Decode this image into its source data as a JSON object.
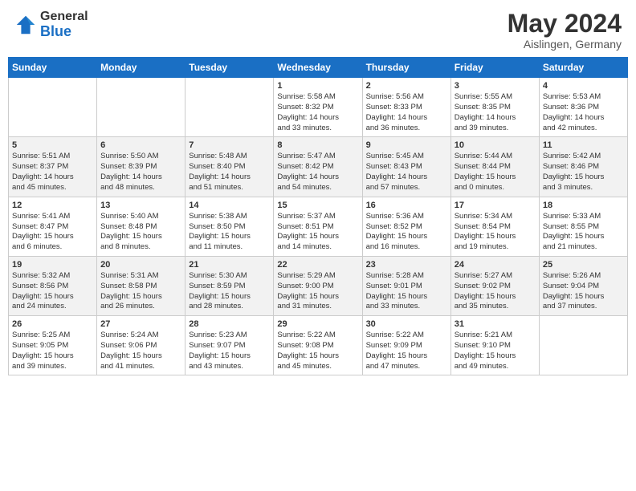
{
  "header": {
    "logo_general": "General",
    "logo_blue": "Blue",
    "title": "May 2024",
    "subtitle": "Aislingen, Germany"
  },
  "calendar": {
    "days_of_week": [
      "Sunday",
      "Monday",
      "Tuesday",
      "Wednesday",
      "Thursday",
      "Friday",
      "Saturday"
    ],
    "weeks": [
      [
        {
          "day": "",
          "info": ""
        },
        {
          "day": "",
          "info": ""
        },
        {
          "day": "",
          "info": ""
        },
        {
          "day": "1",
          "info": "Sunrise: 5:58 AM\nSunset: 8:32 PM\nDaylight: 14 hours\nand 33 minutes."
        },
        {
          "day": "2",
          "info": "Sunrise: 5:56 AM\nSunset: 8:33 PM\nDaylight: 14 hours\nand 36 minutes."
        },
        {
          "day": "3",
          "info": "Sunrise: 5:55 AM\nSunset: 8:35 PM\nDaylight: 14 hours\nand 39 minutes."
        },
        {
          "day": "4",
          "info": "Sunrise: 5:53 AM\nSunset: 8:36 PM\nDaylight: 14 hours\nand 42 minutes."
        }
      ],
      [
        {
          "day": "5",
          "info": "Sunrise: 5:51 AM\nSunset: 8:37 PM\nDaylight: 14 hours\nand 45 minutes."
        },
        {
          "day": "6",
          "info": "Sunrise: 5:50 AM\nSunset: 8:39 PM\nDaylight: 14 hours\nand 48 minutes."
        },
        {
          "day": "7",
          "info": "Sunrise: 5:48 AM\nSunset: 8:40 PM\nDaylight: 14 hours\nand 51 minutes."
        },
        {
          "day": "8",
          "info": "Sunrise: 5:47 AM\nSunset: 8:42 PM\nDaylight: 14 hours\nand 54 minutes."
        },
        {
          "day": "9",
          "info": "Sunrise: 5:45 AM\nSunset: 8:43 PM\nDaylight: 14 hours\nand 57 minutes."
        },
        {
          "day": "10",
          "info": "Sunrise: 5:44 AM\nSunset: 8:44 PM\nDaylight: 15 hours\nand 0 minutes."
        },
        {
          "day": "11",
          "info": "Sunrise: 5:42 AM\nSunset: 8:46 PM\nDaylight: 15 hours\nand 3 minutes."
        }
      ],
      [
        {
          "day": "12",
          "info": "Sunrise: 5:41 AM\nSunset: 8:47 PM\nDaylight: 15 hours\nand 6 minutes."
        },
        {
          "day": "13",
          "info": "Sunrise: 5:40 AM\nSunset: 8:48 PM\nDaylight: 15 hours\nand 8 minutes."
        },
        {
          "day": "14",
          "info": "Sunrise: 5:38 AM\nSunset: 8:50 PM\nDaylight: 15 hours\nand 11 minutes."
        },
        {
          "day": "15",
          "info": "Sunrise: 5:37 AM\nSunset: 8:51 PM\nDaylight: 15 hours\nand 14 minutes."
        },
        {
          "day": "16",
          "info": "Sunrise: 5:36 AM\nSunset: 8:52 PM\nDaylight: 15 hours\nand 16 minutes."
        },
        {
          "day": "17",
          "info": "Sunrise: 5:34 AM\nSunset: 8:54 PM\nDaylight: 15 hours\nand 19 minutes."
        },
        {
          "day": "18",
          "info": "Sunrise: 5:33 AM\nSunset: 8:55 PM\nDaylight: 15 hours\nand 21 minutes."
        }
      ],
      [
        {
          "day": "19",
          "info": "Sunrise: 5:32 AM\nSunset: 8:56 PM\nDaylight: 15 hours\nand 24 minutes."
        },
        {
          "day": "20",
          "info": "Sunrise: 5:31 AM\nSunset: 8:58 PM\nDaylight: 15 hours\nand 26 minutes."
        },
        {
          "day": "21",
          "info": "Sunrise: 5:30 AM\nSunset: 8:59 PM\nDaylight: 15 hours\nand 28 minutes."
        },
        {
          "day": "22",
          "info": "Sunrise: 5:29 AM\nSunset: 9:00 PM\nDaylight: 15 hours\nand 31 minutes."
        },
        {
          "day": "23",
          "info": "Sunrise: 5:28 AM\nSunset: 9:01 PM\nDaylight: 15 hours\nand 33 minutes."
        },
        {
          "day": "24",
          "info": "Sunrise: 5:27 AM\nSunset: 9:02 PM\nDaylight: 15 hours\nand 35 minutes."
        },
        {
          "day": "25",
          "info": "Sunrise: 5:26 AM\nSunset: 9:04 PM\nDaylight: 15 hours\nand 37 minutes."
        }
      ],
      [
        {
          "day": "26",
          "info": "Sunrise: 5:25 AM\nSunset: 9:05 PM\nDaylight: 15 hours\nand 39 minutes."
        },
        {
          "day": "27",
          "info": "Sunrise: 5:24 AM\nSunset: 9:06 PM\nDaylight: 15 hours\nand 41 minutes."
        },
        {
          "day": "28",
          "info": "Sunrise: 5:23 AM\nSunset: 9:07 PM\nDaylight: 15 hours\nand 43 minutes."
        },
        {
          "day": "29",
          "info": "Sunrise: 5:22 AM\nSunset: 9:08 PM\nDaylight: 15 hours\nand 45 minutes."
        },
        {
          "day": "30",
          "info": "Sunrise: 5:22 AM\nSunset: 9:09 PM\nDaylight: 15 hours\nand 47 minutes."
        },
        {
          "day": "31",
          "info": "Sunrise: 5:21 AM\nSunset: 9:10 PM\nDaylight: 15 hours\nand 49 minutes."
        },
        {
          "day": "",
          "info": ""
        }
      ]
    ]
  }
}
